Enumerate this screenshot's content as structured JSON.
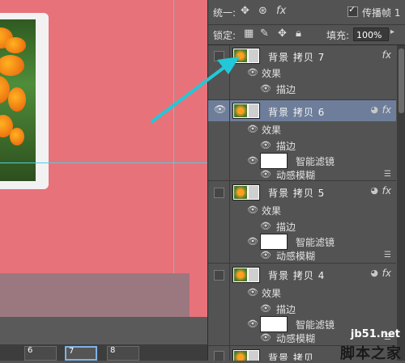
{
  "toolbar": {
    "unify_label": "统一:",
    "propagate_label": "传播帧 1",
    "propagate_checked": true,
    "lock_label": "锁定:",
    "fill_label": "填充:",
    "fill_value": "100%"
  },
  "layers": [
    {
      "name": "背景 拷贝 7",
      "visible": false,
      "selected": false,
      "fx_label": "fx",
      "effects_label": "效果",
      "stroke_label": "描边"
    },
    {
      "name": "背景 拷贝 6",
      "visible": true,
      "selected": true,
      "fx_label": "fx",
      "effects_label": "效果",
      "stroke_label": "描边",
      "smart_filters_label": "智能滤镜",
      "motion_blur_label": "动感模糊"
    },
    {
      "name": "背景 拷贝 5",
      "visible": false,
      "selected": false,
      "fx_label": "fx",
      "effects_label": "效果",
      "stroke_label": "描边",
      "smart_filters_label": "智能滤镜",
      "motion_blur_label": "动感模糊"
    },
    {
      "name": "背景 拷贝 4",
      "visible": false,
      "selected": false,
      "fx_label": "fx",
      "effects_label": "效果",
      "stroke_label": "描边",
      "smart_filters_label": "智能滤镜",
      "motion_blur_label": "动感模糊"
    },
    {
      "name": "背景 拷贝"
    }
  ],
  "timeline": {
    "frames": [
      "6",
      "7",
      "8"
    ],
    "selected_frame": "7"
  },
  "watermark": {
    "site": "jb51.net",
    "brand": "脚本之家"
  },
  "colors": {
    "document_background": "#e8727a",
    "guide": "#4bd0e0",
    "arrow": "#22c8d8",
    "selected_layer": "#6e7e9a"
  }
}
